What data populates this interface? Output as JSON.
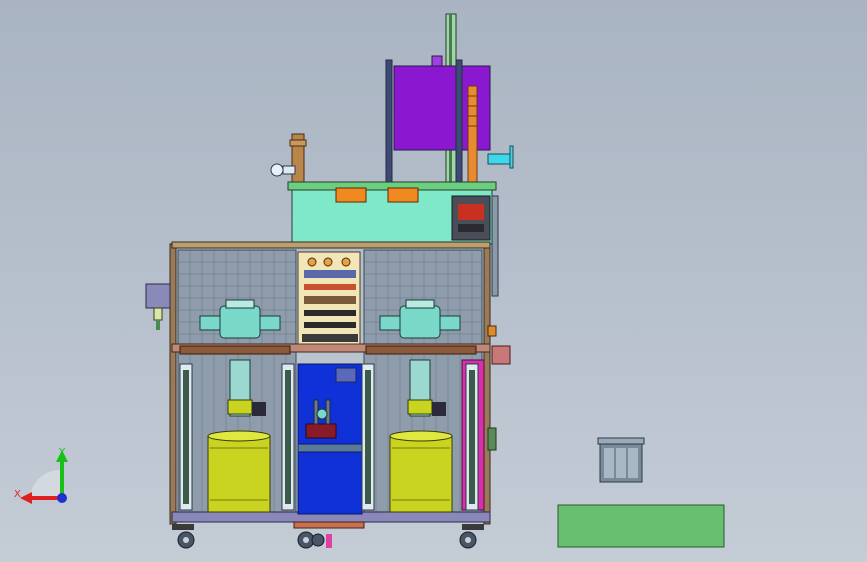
{
  "viewport": {
    "background_top": "#a9b4c2",
    "background_bottom": "#c4ccd6"
  },
  "triad": {
    "x_label": "X",
    "y_label": "Y",
    "x_color": "#e02020",
    "y_color": "#18c018",
    "z_color": "#2030d0"
  },
  "colors": {
    "frame": "#8a6a4a",
    "mesh": "#5a6b7a",
    "cabinet": "#7ee8c8",
    "purple_panel": "#8a18d0",
    "tank": "#c8d420",
    "pump": "#7ad8c8",
    "blue_panel": "#1030d8",
    "control_panel": "#f2e6b8",
    "orange_tag": "#f08a20",
    "green_rect": "#66c070",
    "side_panel": "#d830a8"
  }
}
